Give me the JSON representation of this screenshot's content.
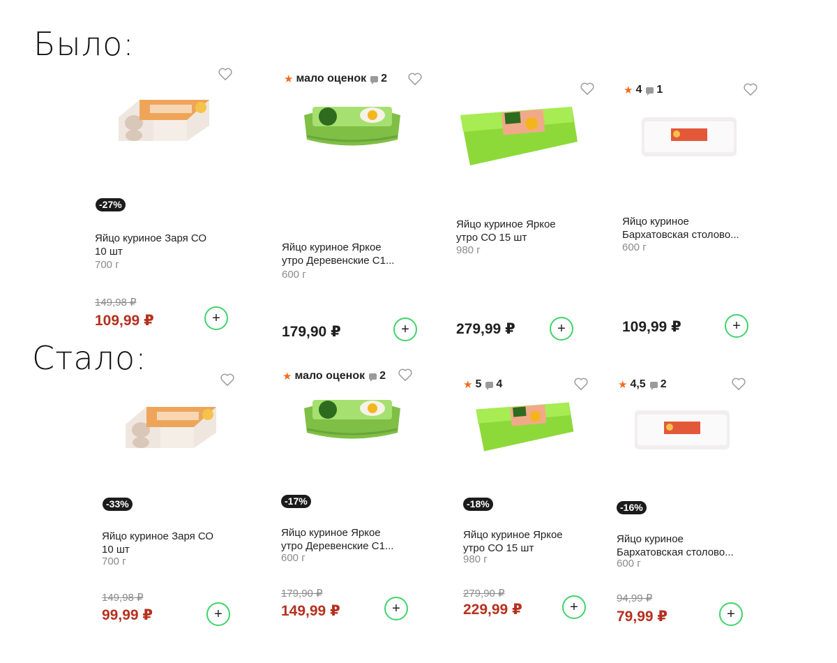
{
  "sections": {
    "before_label": "Было:",
    "after_label": "Стало:"
  },
  "before": [
    {
      "rating": "",
      "comments": "",
      "badge": "-27%",
      "title": "Яйцо куриное Заря СО\n10 шт",
      "weight": "700 г",
      "old_price": "149,98 ₽",
      "price": "109,99 ₽"
    },
    {
      "rating": "мало оценок",
      "comments": "2",
      "badge": "",
      "title": "Яйцо куриное Яркое\nутро Деревенские С1...",
      "weight": "600 г",
      "old_price": "",
      "price": "179,90 ₽"
    },
    {
      "rating": "",
      "comments": "",
      "badge": "",
      "title": "Яйцо куриное Яркое\nутро СО 15 шт",
      "weight": "980 г",
      "old_price": "",
      "price": "279,99 ₽"
    },
    {
      "rating": "4",
      "comments": "1",
      "badge": "",
      "title": "Яйцо куриное\nБархатовская столово...",
      "weight": "600 г",
      "old_price": "",
      "price": "109,99 ₽"
    }
  ],
  "after": [
    {
      "rating": "",
      "comments": "",
      "badge": "-33%",
      "title": "Яйцо куриное Заря СО\n10 шт",
      "weight": "700 г",
      "old_price": "149,98 ₽",
      "price": "99,99 ₽"
    },
    {
      "rating": "мало оценок",
      "comments": "2",
      "badge": "-17%",
      "title": "Яйцо куриное Яркое\nутро Деревенские С1...",
      "weight": "600 г",
      "old_price": "179,90 ₽",
      "price": "149,99 ₽"
    },
    {
      "rating": "5",
      "comments": "4",
      "badge": "-18%",
      "title": "Яйцо куриное Яркое\nутро СО 15 шт",
      "weight": "980 г",
      "old_price": "279,90 ₽",
      "price": "229,99 ₽"
    },
    {
      "rating": "4,5",
      "comments": "2",
      "badge": "-16%",
      "title": "Яйцо куриное\nБархатовская столово...",
      "weight": "600 г",
      "old_price": "94,99 ₽",
      "price": "79,99 ₽"
    }
  ],
  "ui": {
    "add_symbol": "+",
    "star_symbol": "★"
  },
  "colors": {
    "accent_green": "#3fd46a",
    "sale_red": "#b6301f",
    "star_orange": "#f26b1d"
  },
  "icons": {
    "favorite": "heart-icon",
    "add": "plus-icon",
    "rating": "star-icon",
    "comments": "comment-icon"
  }
}
